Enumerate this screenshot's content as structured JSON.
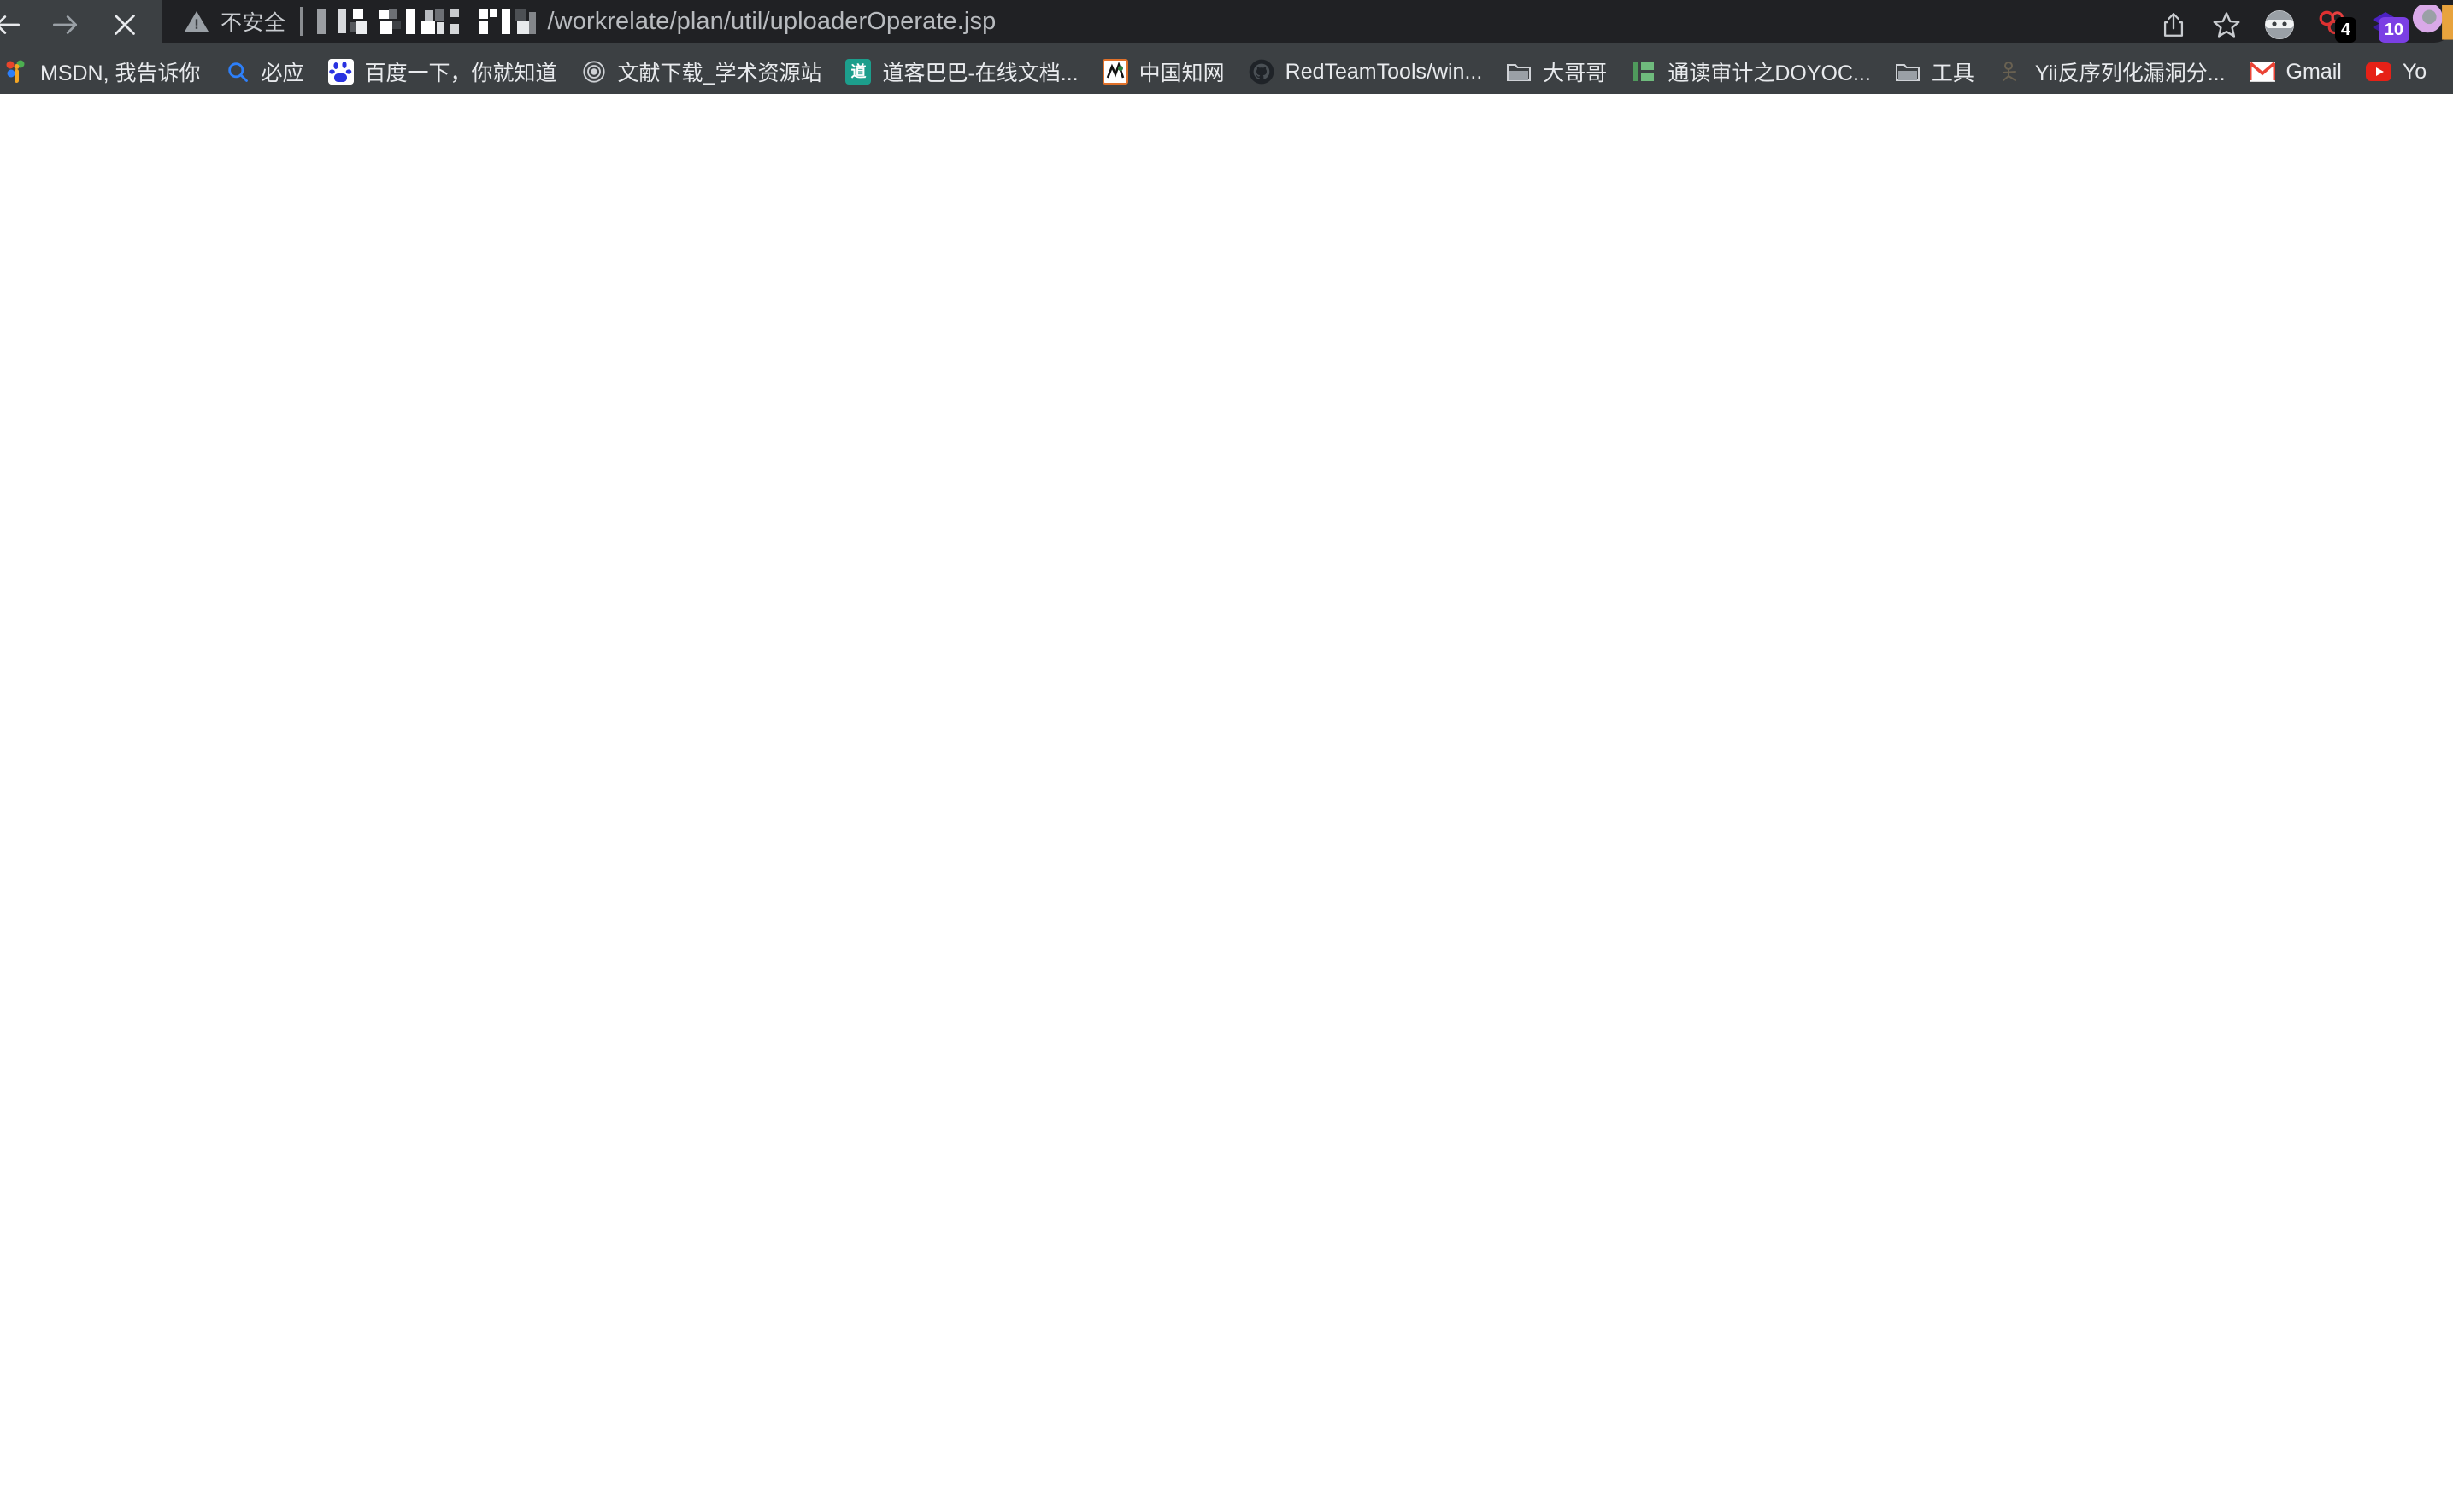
{
  "browser": {
    "nav": {
      "back_icon": "arrow-left-icon",
      "forward_icon": "arrow-right-icon",
      "stop_icon": "close-x-icon"
    },
    "omnibox": {
      "security_icon": "warning-triangle-icon",
      "security_label": "不安全",
      "host_redacted": true,
      "url_path": "/workrelate/plan/util/uploaderOperate.jsp",
      "full_url_visible": "/workrelate/plan/util/uploaderOperate.jsp"
    },
    "toolbar_right": [
      {
        "name": "share-icon",
        "label": "",
        "badge": null
      },
      {
        "name": "bookmark-star-icon",
        "label": "",
        "badge": null
      },
      {
        "name": "profile-avatar-icon",
        "label": "",
        "badge": null
      },
      {
        "name": "extension-red-icon",
        "label": "",
        "badge": "4"
      },
      {
        "name": "extension-purple-icon",
        "label": "",
        "badge": "10"
      },
      {
        "name": "extension-partial-icon",
        "label": "",
        "badge": null
      }
    ],
    "bookmarks": [
      {
        "icon": "msdn-icon",
        "label": "MSDN, 我告诉你"
      },
      {
        "icon": "bing-icon",
        "label": "必应"
      },
      {
        "icon": "baidu-icon",
        "label": "百度一下，你就知道"
      },
      {
        "icon": "document-icon",
        "label": "文献下载_学术资源站"
      },
      {
        "icon": "docin-icon",
        "label": "道客巴巴-在线文档..."
      },
      {
        "icon": "cnki-icon",
        "label": "中国知网"
      },
      {
        "icon": "github-icon",
        "label": "RedTeamTools/win..."
      },
      {
        "icon": "folder-icon",
        "label": "大哥哥"
      },
      {
        "icon": "book-icon",
        "label": "通读审计之DOYOC..."
      },
      {
        "icon": "folder-icon",
        "label": "工具"
      },
      {
        "icon": "yii-icon",
        "label": "Yii反序列化漏洞分..."
      },
      {
        "icon": "gmail-icon",
        "label": "Gmail"
      },
      {
        "icon": "youtube-icon",
        "label": "Yo"
      }
    ]
  },
  "page": {
    "body_text": "",
    "state": "blank-loading"
  },
  "colors": {
    "chrome_bg": "#3c4043",
    "omnibox_bg": "#202124",
    "text_primary": "#e8eaed",
    "text_secondary": "#b8bbbf",
    "page_bg": "#ffffff",
    "badge_purple": "#7b3fe4",
    "badge_dark": "#000000"
  }
}
